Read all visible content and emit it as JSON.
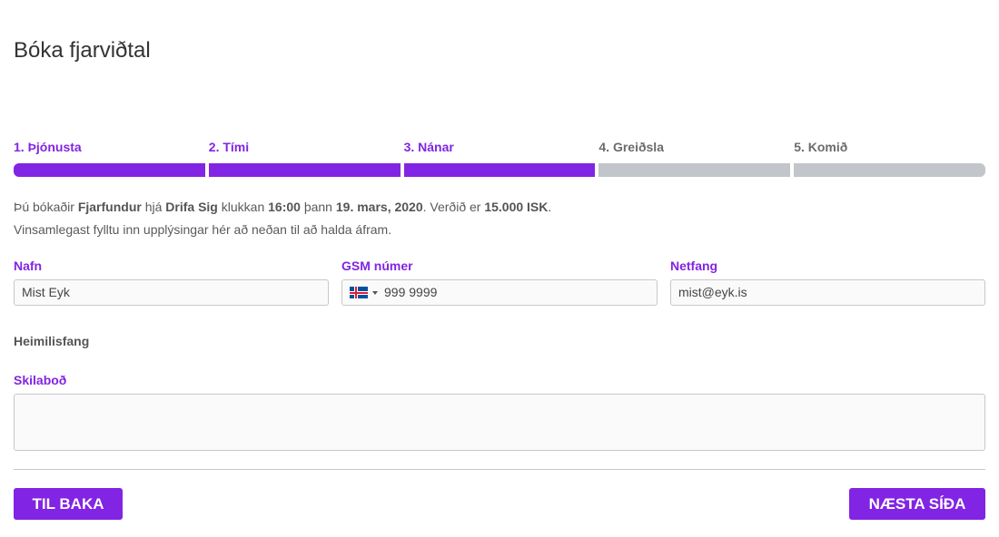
{
  "page": {
    "title": "Bóka fjarviðtal"
  },
  "steps": [
    {
      "label": "1. Þjónusta",
      "state": "active"
    },
    {
      "label": "2. Tími",
      "state": "active"
    },
    {
      "label": "3. Nánar",
      "state": "active"
    },
    {
      "label": "4. Greiðsla",
      "state": "inactive"
    },
    {
      "label": "5. Komið",
      "state": "inactive"
    }
  ],
  "summary": {
    "p1": "Þú bókaðir ",
    "service": "Fjarfundur",
    "p2": " hjá ",
    "staff": "Drifa Sig",
    "p3": " klukkan ",
    "time": "16:00",
    "p4": " þann ",
    "date": "19. mars, 2020",
    "p5": ". Verðið er ",
    "price": "15.000 ISK",
    "p6": ".",
    "line2": "Vinsamlegast fylltu inn upplýsingar hér að neðan til að halda áfram."
  },
  "form": {
    "name_label": "Nafn",
    "name_value": "Mist Eyk",
    "phone_label": "GSM númer",
    "phone_value": "999 9999",
    "email_label": "Netfang",
    "email_value": "mist@eyk.is",
    "address_label": "Heimilisfang",
    "message_label": "Skilaboð",
    "message_value": ""
  },
  "buttons": {
    "back": "TIL BAKA",
    "next": "NÆSTA SÍÐA"
  },
  "colors": {
    "accent": "#8224e3",
    "inactive": "#c2c5ca"
  }
}
